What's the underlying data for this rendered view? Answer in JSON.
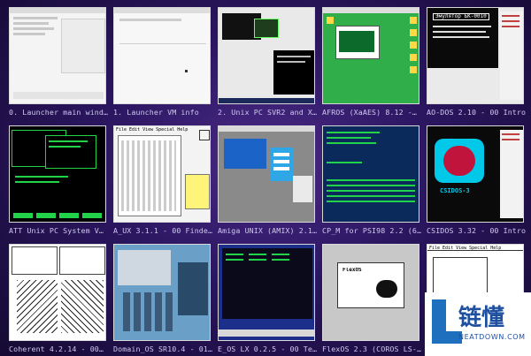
{
  "tiles": [
    {
      "caption": "0. Launcher main wind…"
    },
    {
      "caption": "1. Launcher VM info"
    },
    {
      "caption": "2. Unix PC SVR2 and X…"
    },
    {
      "caption": "AFROS (XaAES) 8.12 -…"
    },
    {
      "caption": "AO-DOS 2.10 - 00 Intro"
    },
    {
      "caption": "ATT Unix PC System V…"
    },
    {
      "caption": "A_UX 3.1.1 - 00 Finde…"
    },
    {
      "caption": "Amiga UNIX (AMIX) 2.1…"
    },
    {
      "caption": "CP_M for PSI98 2.2 (6…"
    },
    {
      "caption": "CSIDOS 3.32 - 00 Intro"
    },
    {
      "caption": "Coherent 4.2.14 - 00…"
    },
    {
      "caption": "Domain_OS SR10.4 - 01…"
    },
    {
      "caption": "E_OS LX 0.2.5 - 00 Te…"
    },
    {
      "caption": "FlexOS 2.3 (COROS LS-…"
    },
    {
      "caption": ""
    }
  ],
  "thumb_text": {
    "emulator_title": "Эмулятор БК-0010",
    "macintosh_header": "File  Edit  View  Special  Help",
    "csidos_logo": "CSIDOS-3",
    "flexos_title": "FlexOS"
  },
  "watermark": {
    "cn": "链懂",
    "en": "NEATDOWN.COM"
  },
  "colors": {
    "bg": "#2b1660",
    "caption": "#cfc9ef",
    "terminal_green": "#22d34a",
    "cyan": "#00c8e8"
  }
}
